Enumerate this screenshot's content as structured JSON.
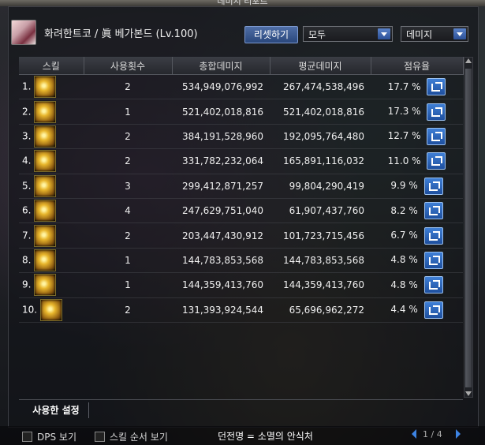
{
  "window": {
    "title": "데미지 리포트"
  },
  "character": {
    "name": "화려한트코 / 眞 베가본드 (Lv.100)"
  },
  "controls": {
    "reset_label": "리셋하기",
    "filter_selected": "모두",
    "metric_selected": "데미지"
  },
  "table": {
    "headers": [
      "스킬",
      "사용횟수",
      "총합데미지",
      "평균데미지",
      "점유율"
    ],
    "rows": [
      {
        "index": "1.",
        "count": "2",
        "total": "534,949,076,992",
        "avg": "267,474,538,496",
        "share": "17.7 %"
      },
      {
        "index": "2.",
        "count": "1",
        "total": "521,402,018,816",
        "avg": "521,402,018,816",
        "share": "17.3 %"
      },
      {
        "index": "3.",
        "count": "2",
        "total": "384,191,528,960",
        "avg": "192,095,764,480",
        "share": "12.7 %"
      },
      {
        "index": "4.",
        "count": "2",
        "total": "331,782,232,064",
        "avg": "165,891,116,032",
        "share": "11.0 %"
      },
      {
        "index": "5.",
        "count": "3",
        "total": "299,412,871,257",
        "avg": "99,804,290,419",
        "share": "9.9 %"
      },
      {
        "index": "6.",
        "count": "4",
        "total": "247,629,751,040",
        "avg": "61,907,437,760",
        "share": "8.2 %"
      },
      {
        "index": "7.",
        "count": "2",
        "total": "203,447,430,912",
        "avg": "101,723,715,456",
        "share": "6.7 %"
      },
      {
        "index": "8.",
        "count": "1",
        "total": "144,783,853,568",
        "avg": "144,783,853,568",
        "share": "4.8 %"
      },
      {
        "index": "9.",
        "count": "1",
        "total": "144,359,413,760",
        "avg": "144,359,413,760",
        "share": "4.8 %"
      },
      {
        "index": "10.",
        "count": "2",
        "total": "131,393,924,544",
        "avg": "65,696,962,272",
        "share": "4.4 %"
      }
    ]
  },
  "tabs": {
    "used_settings": "사용한 설정"
  },
  "footer": {
    "dps_label": "DPS 보기",
    "skill_order_label": "스킬 순서 보기",
    "dungeon": "던전명 = 소멸의 안식처",
    "page": "1 / 4"
  },
  "colors": {
    "accent": "#3d84e3",
    "panel": "#121418"
  }
}
